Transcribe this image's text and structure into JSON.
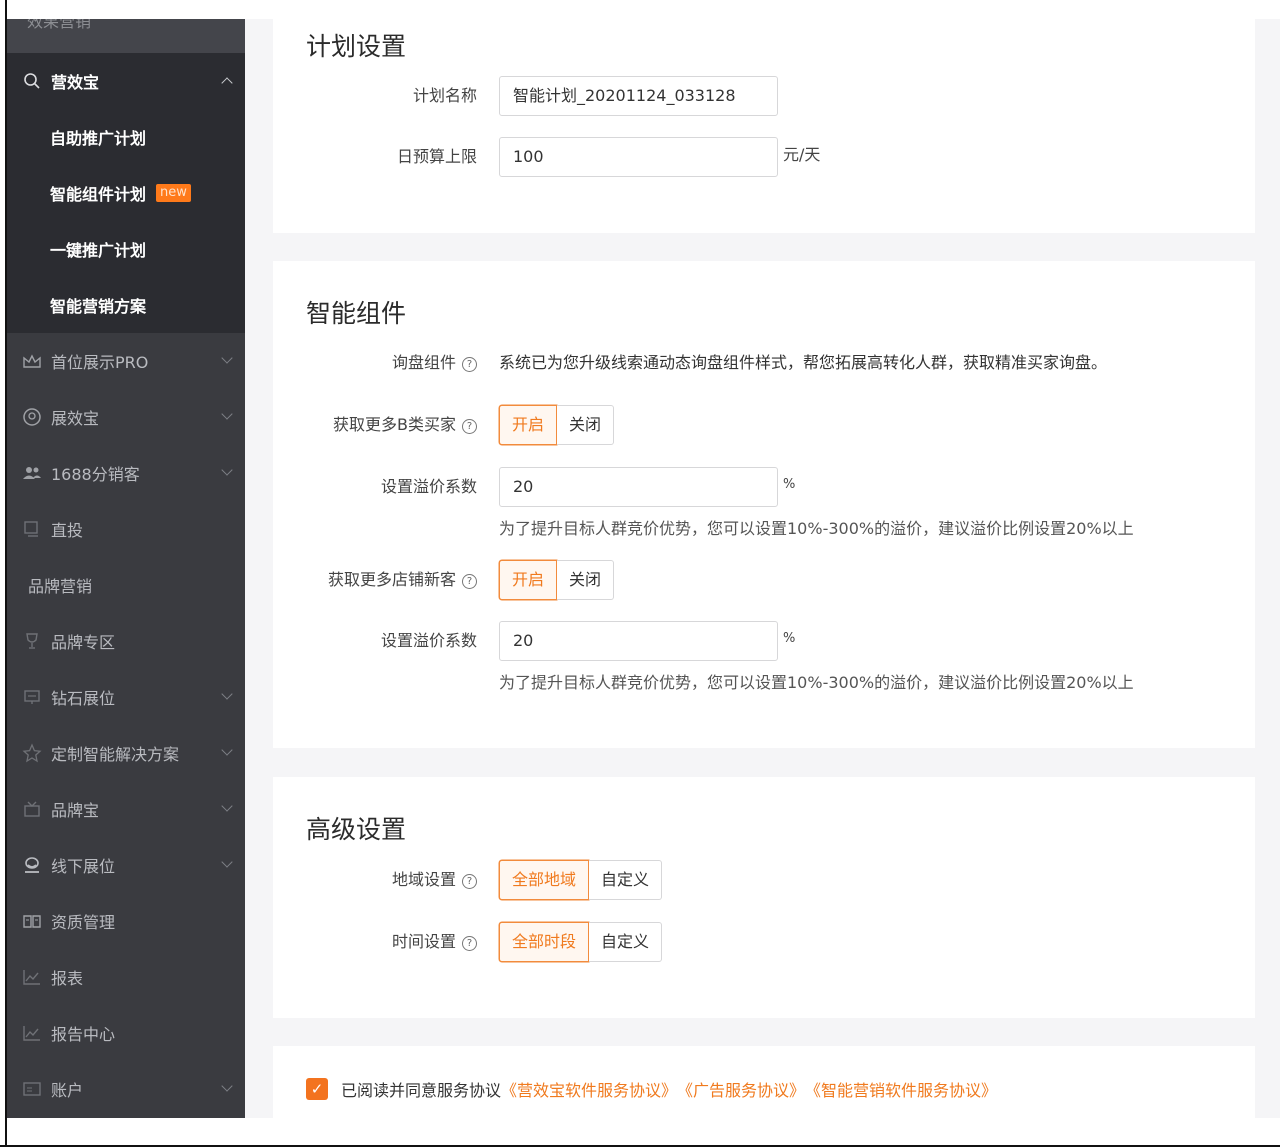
{
  "sidebar": {
    "top_partial": "效果营销",
    "yingxiaobao": {
      "label": "营效宝",
      "icon": "search-icon"
    },
    "sub_items": [
      {
        "label": "自助推广计划"
      },
      {
        "label": "智能组件计划",
        "badge": "new"
      },
      {
        "label": "一键推广计划"
      },
      {
        "label": "智能营销方案"
      }
    ],
    "items": [
      {
        "label": "首位展示PRO",
        "icon": "crown-icon",
        "chevron": true
      },
      {
        "label": "展效宝",
        "icon": "badge-icon",
        "chevron": true
      },
      {
        "label": "1688分销客",
        "icon": "users-icon",
        "chevron": true
      },
      {
        "label": "直投",
        "icon": "monitor-icon",
        "chevron": false
      },
      {
        "label": "品牌营销",
        "icon": "",
        "chevron": false
      },
      {
        "label": "品牌专区",
        "icon": "trophy-icon",
        "chevron": false
      },
      {
        "label": "钻石展位",
        "icon": "screen-icon",
        "chevron": true
      },
      {
        "label": "定制智能解决方案",
        "icon": "star-icon",
        "chevron": true
      },
      {
        "label": "品牌宝",
        "icon": "gift-icon",
        "chevron": true
      },
      {
        "label": "线下展位",
        "icon": "location-icon",
        "chevron": true
      },
      {
        "label": "资质管理",
        "icon": "book-icon",
        "chevron": false
      },
      {
        "label": "报表",
        "icon": "chart-icon",
        "chevron": false
      },
      {
        "label": "报告中心",
        "icon": "chart-icon",
        "chevron": false
      },
      {
        "label": "账户",
        "icon": "card-icon",
        "chevron": true
      }
    ]
  },
  "plan": {
    "title": "计划设置",
    "name_label": "计划名称",
    "name_value": "智能计划_20201124_033128",
    "budget_label": "日预算上限",
    "budget_value": "100",
    "budget_unit": "元/天"
  },
  "component": {
    "title": "智能组件",
    "inquiry_label": "询盘组件",
    "inquiry_text": "系统已为您升级线索通动态询盘组件样式，帮您拓展高转化人群，获取精准买家询盘。",
    "b_buyers_label": "获取更多B类买家",
    "toggle_on": "开启",
    "toggle_off": "关闭",
    "premium_label": "设置溢价系数",
    "premium_value_1": "20",
    "premium_unit": "%",
    "premium_hint": "为了提升目标人群竞价优势，您可以设置10%-300%的溢价，建议溢价比例设置20%以上",
    "new_customers_label": "获取更多店铺新客",
    "premium_value_2": "20"
  },
  "advanced": {
    "title": "高级设置",
    "region_label": "地域设置",
    "region_all": "全部地域",
    "custom": "自定义",
    "time_label": "时间设置",
    "time_all": "全部时段"
  },
  "agreement": {
    "prefix": "已阅读并同意服务协议",
    "link1": "《营效宝软件服务协议》",
    "link2": "《广告服务协议》",
    "link3": "《智能营销软件服务协议》",
    "checked": true
  },
  "colors": {
    "accent": "#f07a1e",
    "sidebar_bg": "#3a3b40"
  }
}
